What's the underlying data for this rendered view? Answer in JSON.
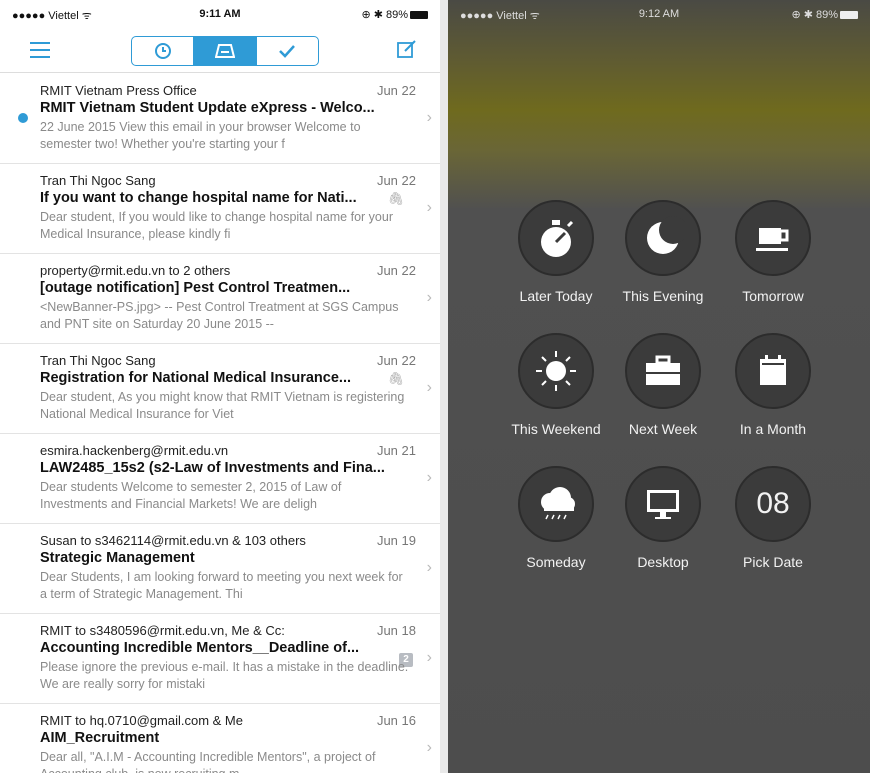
{
  "left": {
    "status": {
      "carrier": "●●●●● Viettel ᯤ",
      "time": "9:11 AM",
      "battery": "⊕ ✱ 89%"
    },
    "toolbar": {
      "segments": [
        "later-icon",
        "inbox-icon",
        "done-icon"
      ]
    },
    "mails": [
      {
        "sender": "RMIT Vietnam Press Office",
        "date": "Jun 22",
        "subject": "RMIT Vietnam Student Update eXpress - Welco...",
        "preview": "22 June 2015 View this email in your browser Welcome to semester two! Whether you're starting your f",
        "unread": true
      },
      {
        "sender": "Tran Thi Ngoc Sang",
        "date": "Jun 22",
        "subject": "If you want to change hospital name for Nati...",
        "preview": "Dear student, If you would like to change hospital name for your Medical Insurance, please kindly fi",
        "attachment": true
      },
      {
        "sender": "property@rmit.edu.vn to 2 others",
        "date": "Jun 22",
        "subject": "[outage notification] Pest Control Treatmen...",
        "preview": "<NewBanner-PS.jpg> -- Pest Control Treatment at SGS Campus and PNT site on Saturday 20 June 2015 --",
        "attachment": true
      },
      {
        "sender": "Tran Thi Ngoc Sang",
        "date": "Jun 22",
        "subject": "Registration for National Medical Insurance...",
        "preview": "Dear student, As you might know that RMIT Vietnam is registering National Medical Insurance for Viet",
        "attachment": true
      },
      {
        "sender": "esmira.hackenberg@rmit.edu.vn",
        "date": "Jun 21",
        "subject": "LAW2485_15s2 (s2-Law of Investments and Fina...",
        "preview": "Dear students Welcome to semester 2, 2015 of Law of Investments and Financial Markets! We are deligh"
      },
      {
        "sender": "Susan to s3462114@rmit.edu.vn & 103 others",
        "date": "Jun 19",
        "subject": "Strategic Management",
        "preview": "Dear Students, I am looking forward to meeting you next week for a term of Strategic Management. Thi"
      },
      {
        "sender": "RMIT to s3480596@rmit.edu.vn, Me & Cc:",
        "date": "Jun 18",
        "subject": "Accounting Incredible Mentors__Deadline of...",
        "preview": "Please ignore the previous e-mail. It has a mistake in the deadline. We are really sorry for mistaki",
        "count": "2"
      },
      {
        "sender": "RMIT to hq.0710@gmail.com & Me",
        "date": "Jun 16",
        "subject": "AIM_Recruitment",
        "preview": "Dear all, \"A.I.M - Accounting Incredible Mentors\", a project of Accounting club, is now recruiting m"
      }
    ]
  },
  "right": {
    "status": {
      "carrier": "●●●●● Viettel ᯤ",
      "time": "9:12 AM",
      "battery": "⊕ ✱ 89%"
    },
    "options": [
      {
        "label": "Later Today",
        "icon": "stopwatch-icon"
      },
      {
        "label": "This Evening",
        "icon": "moon-icon"
      },
      {
        "label": "Tomorrow",
        "icon": "coffee-cup-icon"
      },
      {
        "label": "This Weekend",
        "icon": "sun-icon"
      },
      {
        "label": "Next Week",
        "icon": "briefcase-icon"
      },
      {
        "label": "In a Month",
        "icon": "calendar-icon"
      },
      {
        "label": "Someday",
        "icon": "rain-cloud-icon"
      },
      {
        "label": "Desktop",
        "icon": "monitor-icon"
      },
      {
        "label": "Pick Date",
        "icon": "date-number",
        "value": "08"
      }
    ]
  },
  "colors": {
    "accent": "#2f9bd6",
    "overlay": "#4d4d4d",
    "circle": "#3b3b3b"
  }
}
